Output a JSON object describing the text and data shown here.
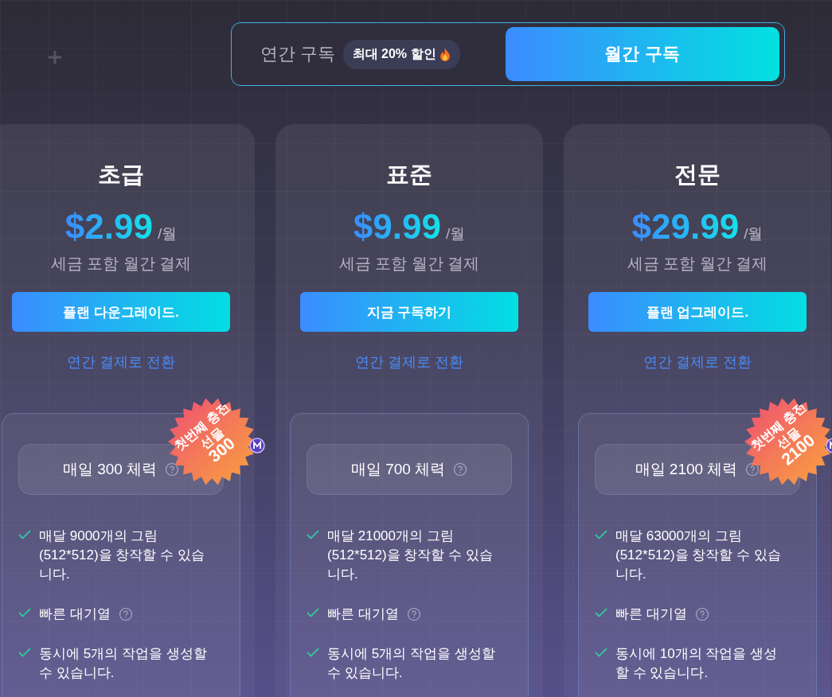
{
  "billing_toggle": {
    "options": [
      {
        "label": "연간 구독",
        "badge": "최대 20% 할인",
        "selected": false
      },
      {
        "label": "월간 구독",
        "selected": true
      }
    ]
  },
  "plans": [
    {
      "name": "초급",
      "price": "$2.99",
      "period": "/월",
      "note": "세금 포함 월간 결제",
      "button": "플랜 다운그레이드.",
      "switch_link": "연간 결제로 전환",
      "gift_badge": {
        "title": "첫번째 충전 선물",
        "amount": "300"
      },
      "energy": "매일 300 체력",
      "features": [
        {
          "text": "매달 9000개의 그림 (512*512)을 창작할 수 있습니다.",
          "help": false
        },
        {
          "text": "빠른 대기열",
          "help": true
        },
        {
          "text": "동시에 5개의 작업을 생성할 수 있습니다.",
          "help": false
        }
      ]
    },
    {
      "name": "표준",
      "price": "$9.99",
      "period": "/월",
      "note": "세금 포함 월간 결제",
      "button": "지금 구독하기",
      "switch_link": "연간 결제로 전환",
      "energy": "매일 700 체력",
      "features": [
        {
          "text": "매달 21000개의 그림 (512*512)을 창작할 수 있습니다.",
          "help": false
        },
        {
          "text": "빠른 대기열",
          "help": true
        },
        {
          "text": "동시에 5개의 작업을 생성할 수 있습니다.",
          "help": false
        }
      ]
    },
    {
      "name": "전문",
      "price": "$29.99",
      "period": "/월",
      "note": "세금 포함 월간 결제",
      "button": "플랜 업그레이드.",
      "switch_link": "연간 결제로 전환",
      "gift_badge": {
        "title": "첫번째 충전 선물",
        "amount": "2100"
      },
      "energy": "매일 2100 체력",
      "features": [
        {
          "text": "매달 63000개의 그림 (512*512)을 창작할 수 있습니다.",
          "help": false
        },
        {
          "text": "빠른 대기열",
          "help": true
        },
        {
          "text": "동시에 10개의 작업을 생성할 수 있습니다.",
          "help": false
        }
      ]
    }
  ]
}
